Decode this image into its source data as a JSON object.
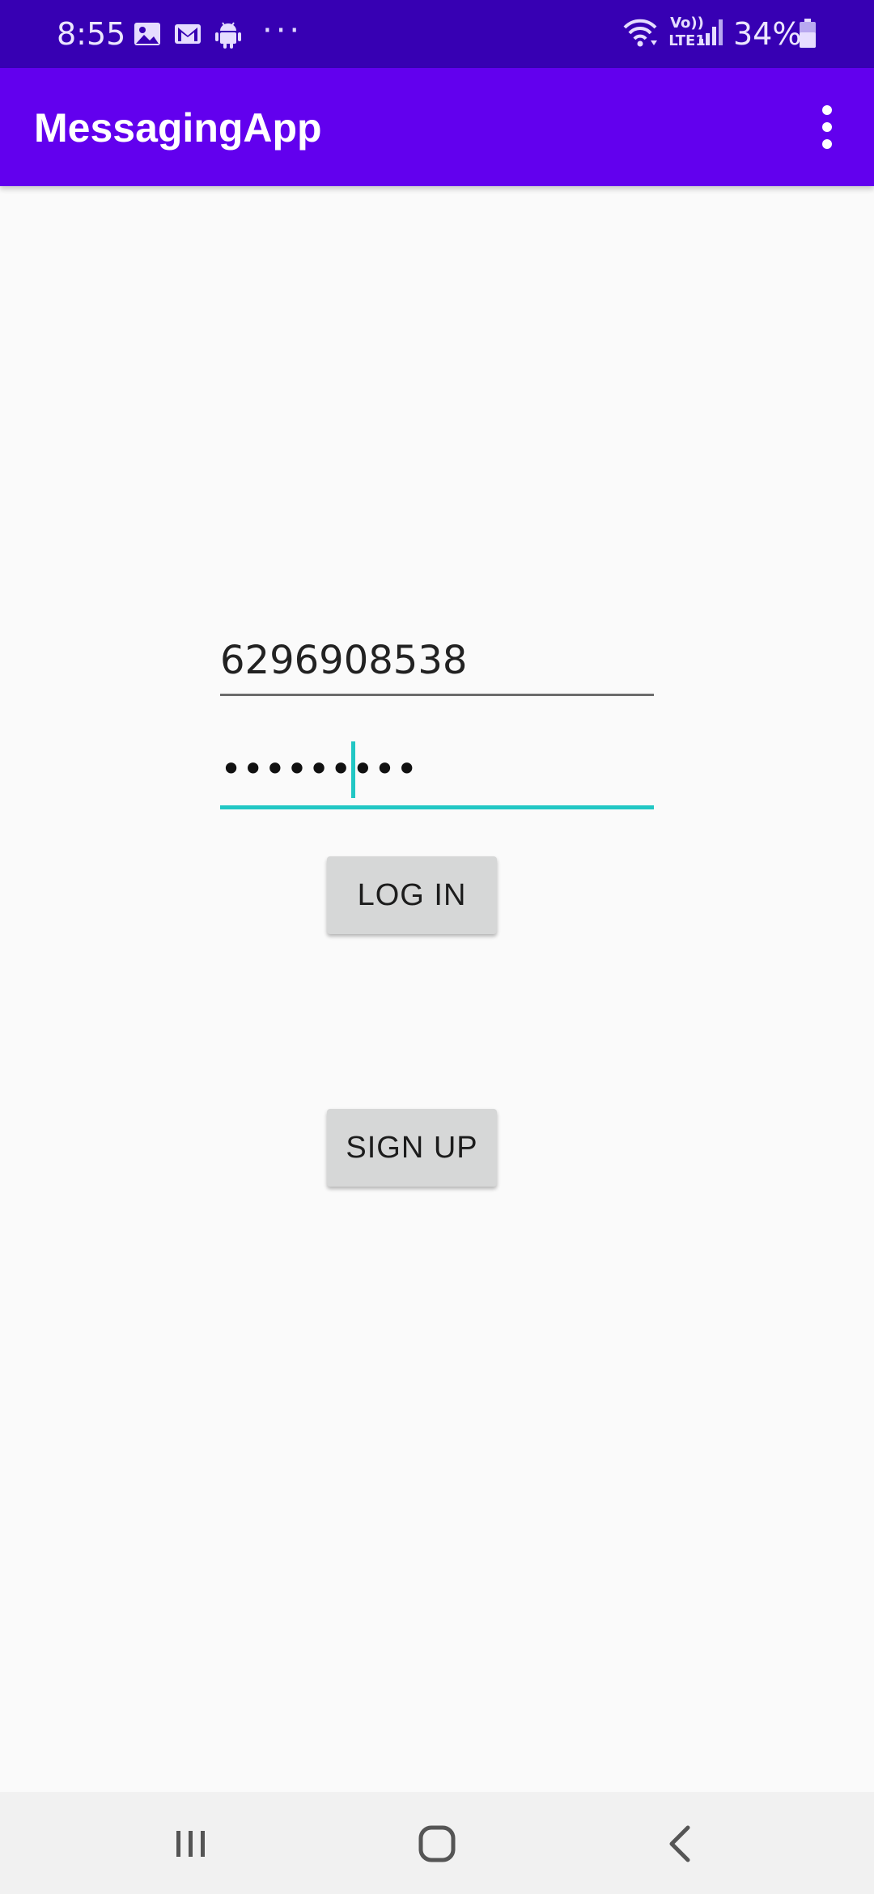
{
  "status_bar": {
    "time": "8:55",
    "overflow_dots": "···",
    "network_label_top": "Vo))",
    "network_label_bottom": "LTE1",
    "battery_percent": "34%",
    "left_icons": [
      "gallery-icon",
      "gmail-icon",
      "android-icon"
    ],
    "right_icons": [
      "wifi-icon",
      "signal-icon",
      "battery-icon"
    ]
  },
  "app_bar": {
    "title": "MessagingApp",
    "menu_icon": "more-vert-icon",
    "color": "#6200ee"
  },
  "form": {
    "phone_value": "6296908538",
    "password_value": "•••••••••",
    "focus_color": "#21c7c4",
    "login_label": "LOG IN",
    "signup_label": "SIGN UP"
  },
  "nav_bar": {
    "icons": [
      "recent-apps-icon",
      "home-icon",
      "back-icon"
    ]
  },
  "colors": {
    "status_bar": "#3700b3",
    "background": "#fafafa",
    "button": "#d6d7d7"
  }
}
